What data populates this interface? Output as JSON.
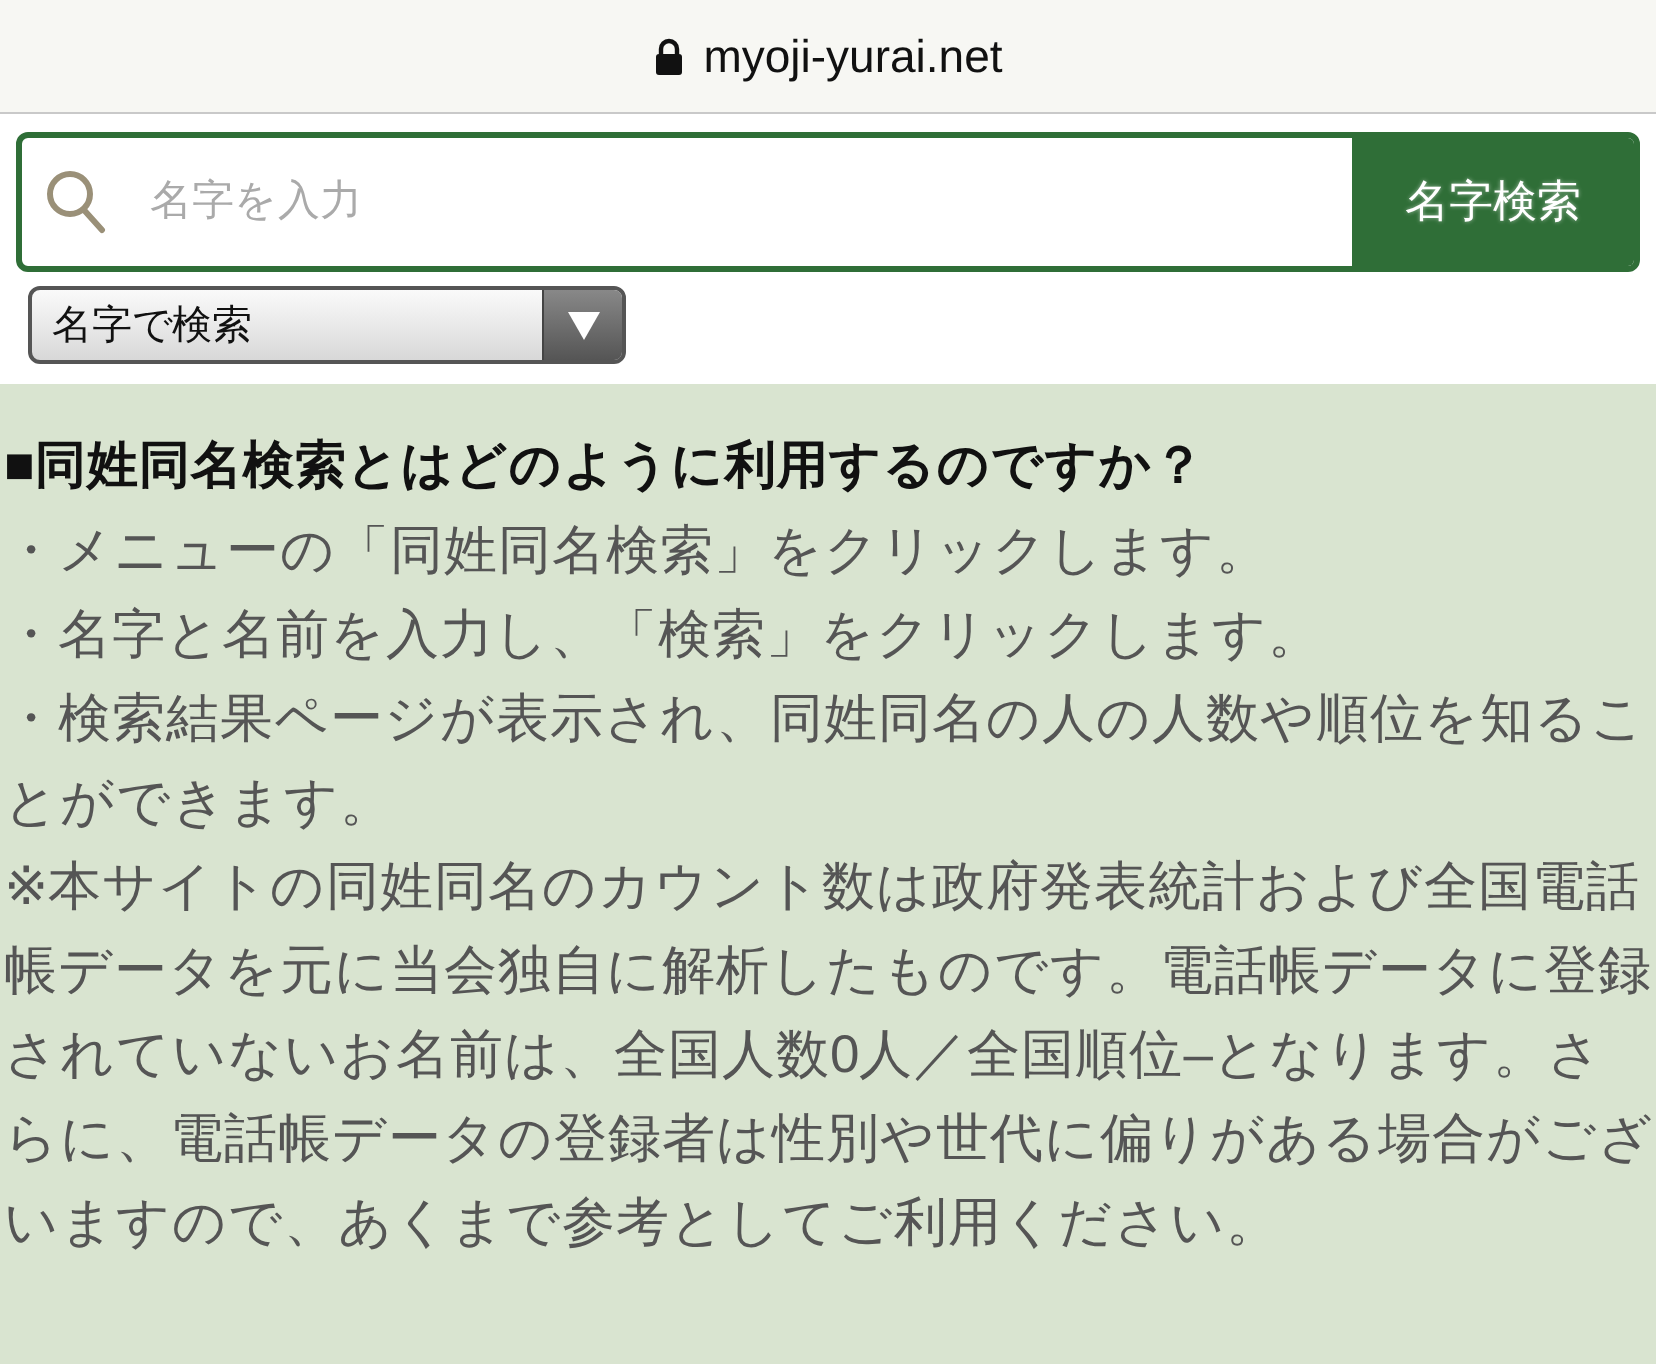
{
  "address_bar": {
    "url": "myoji-yurai.net"
  },
  "search": {
    "placeholder": "名字を入力",
    "button": "名字検索",
    "mode": "名字で検索"
  },
  "faq": {
    "heading": "■同姓同名検索とはどのように利用するのですか？",
    "paragraphs": [
      "・メニューの「同姓同名検索」をクリックします。",
      "・名字と名前を入力し、「検索」をクリックします。",
      "・検索結果ページが表示され、同姓同名の人の人数や順位を知ることができます。",
      "※本サイトの同姓同名のカウント数は政府発表統計および全国電話帳データを元に当会独自に解析したものです。電話帳データに登録されていないお名前は、全国人数0人／全国順位–となります。さらに、電話帳データの登録者は性別や世代に偏りがある場合がございますので、あくまで参考としてご利用ください。"
    ]
  }
}
